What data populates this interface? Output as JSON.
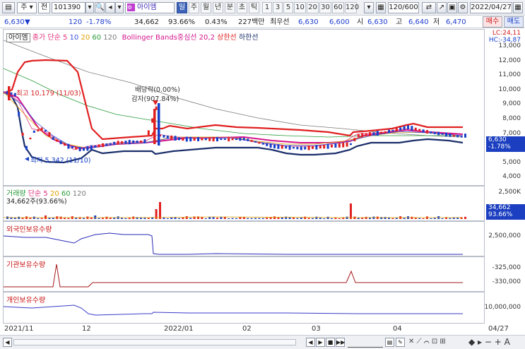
{
  "toolbar": {
    "market_code": "주",
    "period_code": "전",
    "ticker": "101390",
    "stock_name": "아이엠",
    "periods": [
      "일",
      "주",
      "월",
      "년",
      "분",
      "초",
      "틱"
    ],
    "selected_period": "일",
    "intervals": [
      "1",
      "3",
      "5",
      "10",
      "20",
      "30",
      "60",
      "120"
    ],
    "count": "120/600",
    "date": "2022/04/27",
    "buy_label": "매수",
    "sell_label": "매도"
  },
  "quote": {
    "price": "6,630",
    "change": "120",
    "change_pct": "-1.78%",
    "volume": "34,662",
    "volume_ratio": "93.66%",
    "turnover_ratio": "0.43%",
    "amount": "227백만",
    "best_ask_label": "최우선",
    "best_ask": "6,630",
    "best_bid": "6,600",
    "open_label": "시",
    "open": "6,630",
    "high_label": "고",
    "high": "6,640",
    "low_label": "저",
    "low": "6,470"
  },
  "price_panel": {
    "title": "아이엠",
    "legend": {
      "ma_label": "종가 단순",
      "ma5": "5",
      "ma10": "10",
      "ma20": "20",
      "ma60": "60",
      "ma120": "120",
      "bb_label": "Bollinger Bands중심선 20,2",
      "bb_upper": "상한선",
      "bb_lower": "하한선"
    },
    "lc": "LC:24,11",
    "hc": "HC:-34,87",
    "high_note": "최고 10,179 (11/03)",
    "low_note": "최저 5,342 (11/10)",
    "event1": "배당락(0.00%)",
    "event2": "감자(907.84%)",
    "y_ticks": [
      "13,000",
      "12,000",
      "11,000",
      "10,000",
      "9,000",
      "8,000",
      "7,000",
      "6,000",
      "5,000",
      "4,000"
    ],
    "last_price": "6,630",
    "last_pct": "-1.78%"
  },
  "volume_panel": {
    "legend_label": "거래량",
    "ma_label": "단순",
    "ma5": "5",
    "ma20": "20",
    "ma60": "60",
    "ma120": "120",
    "info": "34,662주(93.66%)",
    "y_tick": "2,500K",
    "last_volume": "34,662",
    "last_pct": "93.66%"
  },
  "foreign_panel": {
    "label": "외국인보유수량",
    "y_tick": "2,500,000"
  },
  "inst_panel": {
    "label": "기관보유수량",
    "y_ticks": [
      "-325,000",
      "-330,000"
    ]
  },
  "indiv_panel": {
    "label": "개인보유수량",
    "y_tick": "10,000,000"
  },
  "x_axis": [
    "2021/11",
    "12",
    "2022/01",
    "02",
    "03",
    "04",
    "04/27"
  ],
  "colors": {
    "up": "#e02020",
    "down": "#1740c8",
    "ma5": "#e0307a",
    "ma20": "#e0a000",
    "bb": "#d4148c"
  }
}
